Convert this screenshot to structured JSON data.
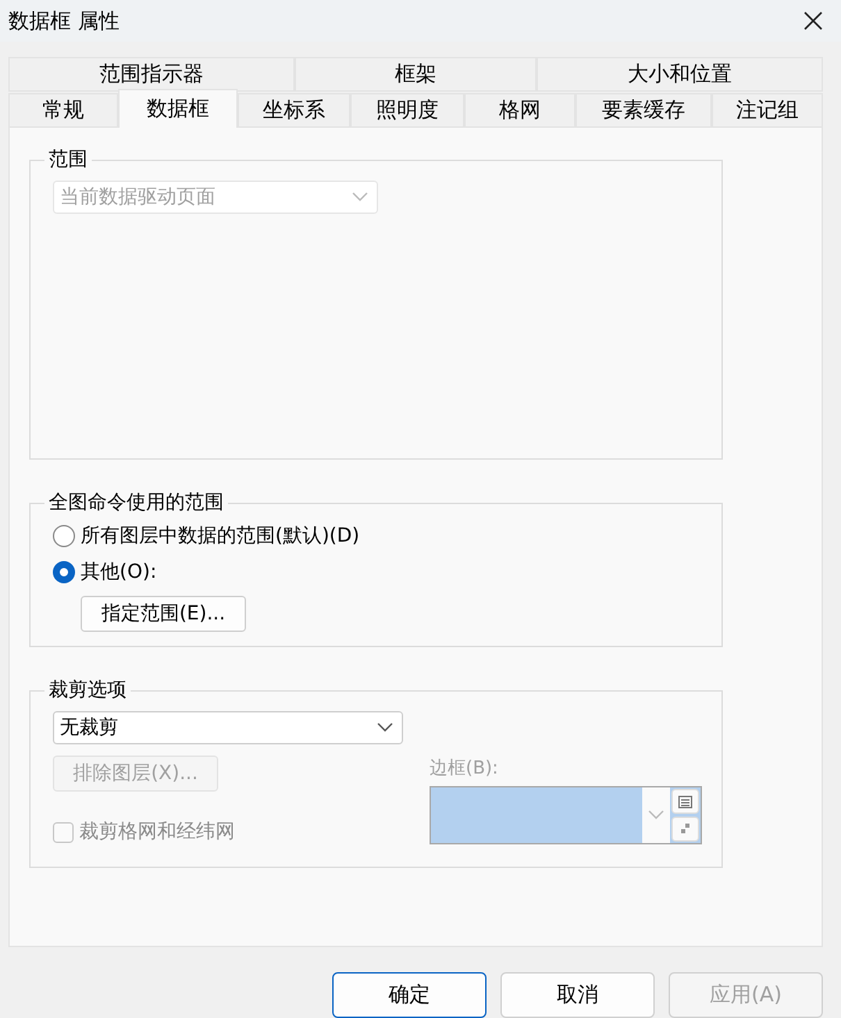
{
  "window": {
    "title": "数据框 属性"
  },
  "tab_rows": [
    [
      {
        "label": "范围指示器",
        "selected": false
      },
      {
        "label": "框架",
        "selected": false
      },
      {
        "label": "大小和位置",
        "selected": false
      }
    ],
    [
      {
        "label": "常规",
        "selected": false
      },
      {
        "label": "数据框",
        "selected": true
      },
      {
        "label": "坐标系",
        "selected": false
      },
      {
        "label": "照明度",
        "selected": false
      },
      {
        "label": "格网",
        "selected": false
      },
      {
        "label": "要素缓存",
        "selected": false
      },
      {
        "label": "注记组",
        "selected": false
      }
    ]
  ],
  "extent": {
    "title": "范围",
    "dropdown": {
      "value": "当前数据驱动页面",
      "disabled": true
    }
  },
  "full_extent": {
    "title": "全图命令使用的范围",
    "options": [
      {
        "label": "所有图层中数据的范围(默认)(D)",
        "selected": false
      },
      {
        "label": "其他(O):",
        "selected": true
      }
    ],
    "button": {
      "label": "指定范围(E)...",
      "disabled": false
    }
  },
  "clip": {
    "title": "裁剪选项",
    "dropdown": {
      "value": "无裁剪",
      "disabled": false
    },
    "exclude_button": {
      "label": "排除图层(X)...",
      "disabled": true
    },
    "border": {
      "label": "边框(B):",
      "disabled": true
    },
    "checkbox": {
      "label": "裁剪格网和经纬网",
      "checked": false,
      "disabled": true
    }
  },
  "buttons": [
    {
      "label": "确定",
      "default": true,
      "disabled": false
    },
    {
      "label": "取消",
      "default": false,
      "disabled": false
    },
    {
      "label": "应用(A)",
      "default": false,
      "disabled": true
    }
  ]
}
